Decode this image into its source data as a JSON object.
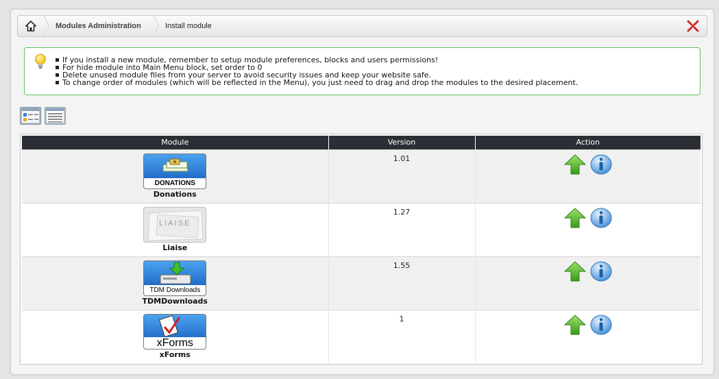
{
  "breadcrumb": {
    "home_icon": "home-icon",
    "items": [
      "Modules Administration",
      "Install module"
    ],
    "close_icon": "close-x-icon"
  },
  "tips": {
    "icon": "lightbulb-icon",
    "items": [
      "If you install a new module, remember to setup module preferences, blocks and users permissions!",
      "For hide module into Main Menu block, set order to 0",
      "Delete unused module files from your server to avoid security issues and keep your website safe.",
      "To change order of modules (which will be reflected in the Menu), you just need to drag and drop the modules to the desired placement."
    ]
  },
  "view_buttons": [
    "icon-view-icon",
    "list-view-icon"
  ],
  "table": {
    "headers": [
      "Module",
      "Version",
      "Action"
    ],
    "rows": [
      {
        "image_text": "DONATIONS",
        "name": "Donations",
        "version": "1.01"
      },
      {
        "image_text": "LIAISE",
        "name": "Liaise",
        "version": "1.27"
      },
      {
        "image_text": "TDM Downloads",
        "name": "TDMDownloads",
        "version": "1.55"
      },
      {
        "image_text": "xForms",
        "name": "xForms",
        "version": "1"
      }
    ],
    "action_icons": [
      "install-arrow-icon",
      "info-icon"
    ]
  },
  "colors": {
    "header_bg": "#2b2f35",
    "tips_border": "#5cc25c",
    "row_alt": "#f0f0f0"
  }
}
